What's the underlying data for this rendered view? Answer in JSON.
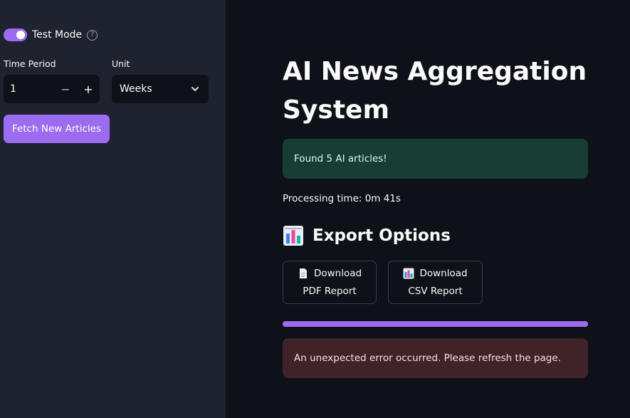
{
  "sidebar": {
    "test_mode": {
      "label": "Test Mode",
      "on": true,
      "help_icon": "question-circle-icon"
    },
    "time_period": {
      "label": "Time Period",
      "value": "1",
      "minus": "−",
      "plus": "+"
    },
    "unit": {
      "label": "Unit",
      "value": "Weeks"
    },
    "fetch_button": "Fetch New Articles"
  },
  "main": {
    "title": "AI News Aggregation System",
    "success_message": "Found 5 AI articles!",
    "processing_time": "Processing time: 0m 41s",
    "export": {
      "heading": "Export Options",
      "icon": "bar-chart-icon",
      "pdf_button": {
        "line1": "Download",
        "line2": "PDF Report",
        "icon": "document-icon"
      },
      "csv_button": {
        "line1": "Download",
        "line2": "CSV Report",
        "icon": "bar-chart-icon"
      }
    },
    "progress": 1.0,
    "error_message": "An unexpected error occurred. Please refresh the page."
  },
  "colors": {
    "accent": "#9b6cf0",
    "sidebar_bg": "#1f2330",
    "main_bg": "#0e1117",
    "success_bg": "#173d35",
    "error_bg": "#3e2329"
  }
}
